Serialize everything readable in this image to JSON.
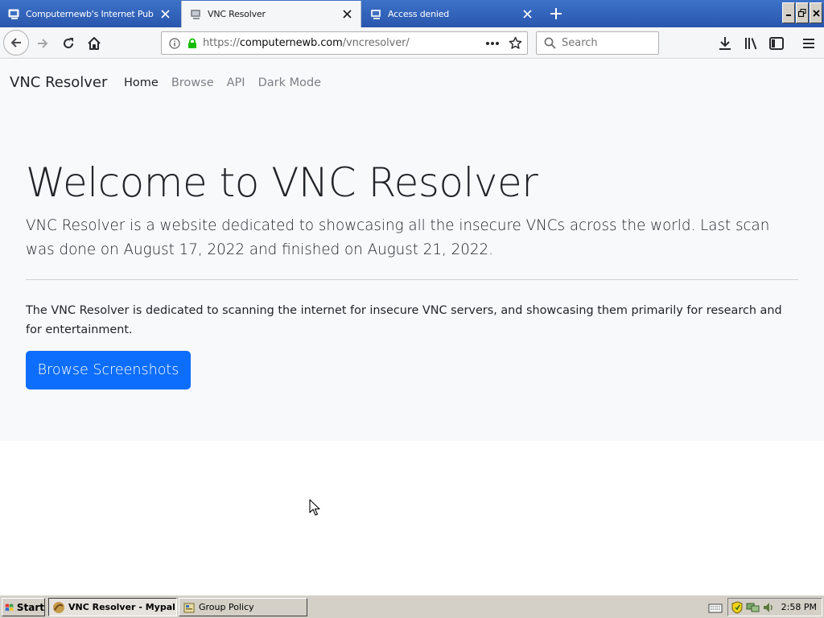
{
  "browser": {
    "tabs": [
      {
        "title": "Computernewb's Internet Pub Hub",
        "active": false
      },
      {
        "title": "VNC Resolver",
        "active": true
      },
      {
        "title": "Access denied",
        "active": false
      }
    ],
    "url": {
      "prefix": "https://",
      "host": "computernewb.com",
      "path": "/vncresolver/"
    },
    "search_placeholder": "Search"
  },
  "site": {
    "brand": "VNC Resolver",
    "nav": [
      "Home",
      "Browse",
      "API",
      "Dark Mode"
    ],
    "heading": "Welcome to VNC Resolver",
    "lead": "VNC Resolver is a website dedicated to showcasing all the insecure VNCs across the world. Last scan was done on August 17, 2022 and finished on August 21, 2022.",
    "paragraph": "The VNC Resolver is dedicated to scanning the internet for insecure VNC servers, and showcasing them primarily for research and for entertainment.",
    "cta_label": "Browse Screenshots"
  },
  "taskbar": {
    "start_label": "Start",
    "items": [
      {
        "label": "VNC Resolver - Mypal",
        "pressed": true
      },
      {
        "label": "Group Policy",
        "pressed": false
      }
    ],
    "clock": "2:58 PM"
  },
  "colors": {
    "tab_bar": "#2956ad",
    "primary_button": "#0d6efd",
    "hero_bg": "#f8f9fa",
    "secure_lock": "#12bc00"
  }
}
